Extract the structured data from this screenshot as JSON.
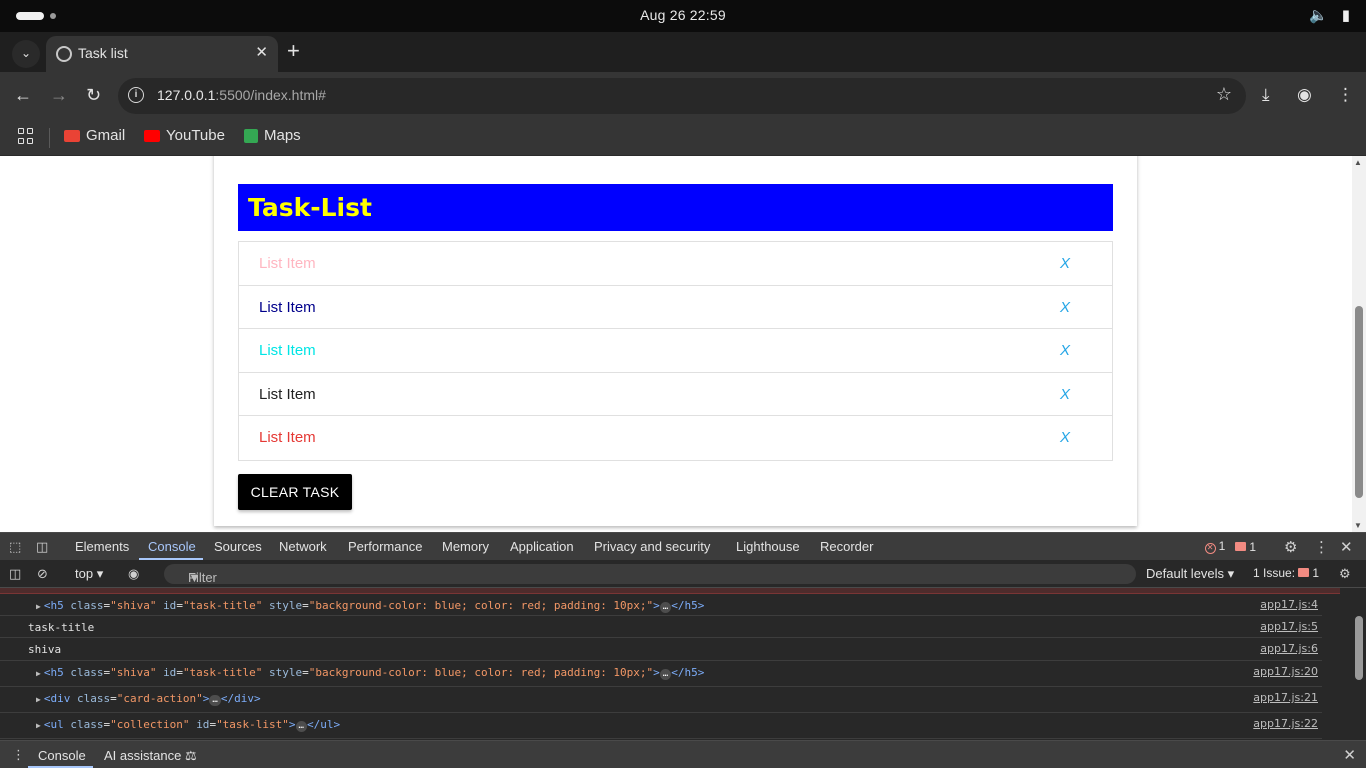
{
  "os": {
    "clock": "Aug 26  22:59",
    "icons": [
      "activities-pill-icon",
      "workspace-dot-icon",
      "volume-icon",
      "battery-icon"
    ]
  },
  "browser": {
    "tab_title": "Task list",
    "url_host": "127.0.0.1",
    "url_rest": ":5500/index.html#",
    "bookmarks": [
      {
        "label": "Gmail",
        "icon": "gmail-icon",
        "color": "#ea4335"
      },
      {
        "label": "YouTube",
        "icon": "youtube-icon",
        "color": "#ff0000"
      },
      {
        "label": "Maps",
        "icon": "maps-icon",
        "color": "#34a853"
      }
    ]
  },
  "page": {
    "title": "Task-List",
    "title_bg": "#0000ff",
    "title_color": "#ffff00",
    "items": [
      {
        "label": "List Item",
        "color": "#ffb6c1",
        "delete": "X"
      },
      {
        "label": "List Item",
        "color": "#00008b",
        "delete": "X"
      },
      {
        "label": "List Item",
        "color": "#00e5e5",
        "delete": "X"
      },
      {
        "label": "List Item",
        "color": "#212121",
        "delete": "X"
      },
      {
        "label": "List Item",
        "color": "#e53935",
        "delete": "X"
      }
    ],
    "clear_button": "CLEAR TASK"
  },
  "devtools": {
    "tabs": [
      "Elements",
      "Console",
      "Sources",
      "Network",
      "Performance",
      "Memory",
      "Application",
      "Privacy and security",
      "Lighthouse",
      "Recorder"
    ],
    "active_tab": "Console",
    "error_count": "1",
    "warning_count": "1",
    "context": "top",
    "filter_placeholder": "Filter",
    "levels": "Default levels",
    "issues_label": "1 Issue:",
    "issues_count": "1",
    "console_rows": [
      {
        "kind": "node",
        "tag_open": "<h5",
        "attrs": [
          [
            "class",
            "\"shiva\""
          ],
          [
            "id",
            "\"task-title\""
          ],
          [
            "style",
            "\"background-color: blue; color: red; padding: 10px;\""
          ]
        ],
        "tag_close": "</h5>",
        "source": "app17.js:4"
      },
      {
        "kind": "text",
        "text": "task-title",
        "source": "app17.js:5"
      },
      {
        "kind": "text",
        "text": "shiva",
        "source": "app17.js:6"
      },
      {
        "kind": "node",
        "tag_open": "<h5",
        "attrs": [
          [
            "class",
            "\"shiva\""
          ],
          [
            "id",
            "\"task-title\""
          ],
          [
            "style",
            "\"background-color: blue; color: red; padding: 10px;\""
          ]
        ],
        "tag_close": "</h5>",
        "source": "app17.js:20"
      },
      {
        "kind": "node",
        "tag_open": "<div",
        "attrs": [
          [
            "class",
            "\"card-action\""
          ]
        ],
        "tag_close": "</div>",
        "source": "app17.js:21"
      },
      {
        "kind": "node",
        "tag_open": "<ul",
        "attrs": [
          [
            "class",
            "\"collection\""
          ],
          [
            "id",
            "\"task-list\""
          ]
        ],
        "tag_close": "</ul>",
        "source": "app17.js:22"
      }
    ],
    "drawer_tabs": [
      "Console",
      "AI assistance"
    ]
  }
}
